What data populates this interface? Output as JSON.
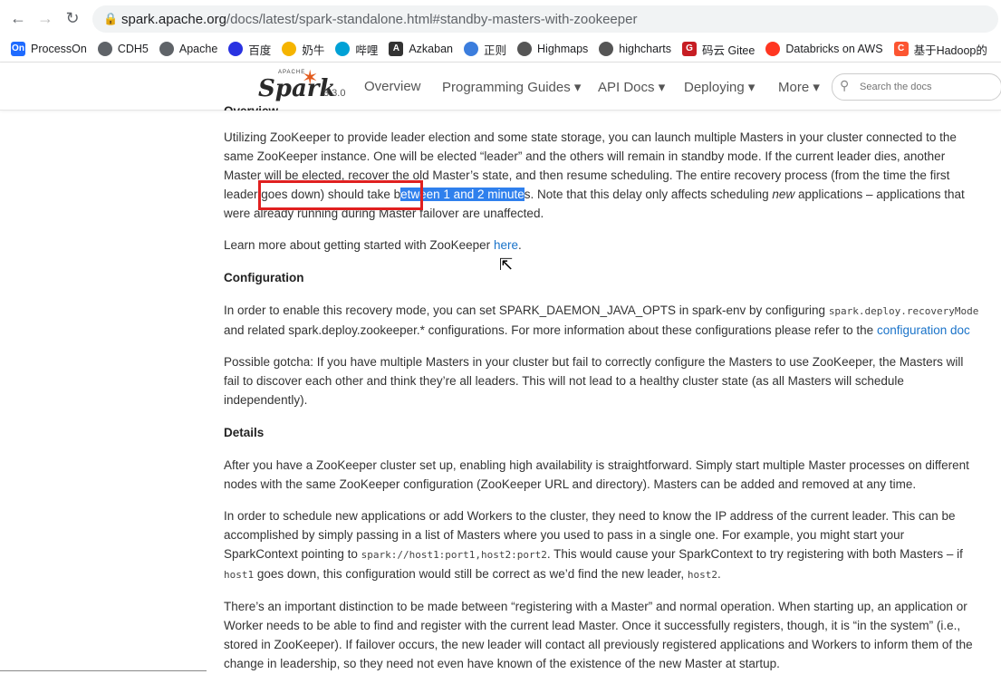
{
  "browser": {
    "url_host": "spark.apache.org",
    "url_path": "/docs/latest/spark-standalone.html#standby-masters-with-zookeeper",
    "bookmarks": [
      {
        "label": "ProcessOn",
        "icon": "On",
        "color": "#1f6bff"
      },
      {
        "label": "CDH5",
        "icon": "globe",
        "color": "#5f6368"
      },
      {
        "label": "Apache",
        "icon": "globe",
        "color": "#5f6368"
      },
      {
        "label": "百度",
        "icon": "paw",
        "color": "#2932e1"
      },
      {
        "label": "奶牛",
        "icon": "cow",
        "color": "#f5b400"
      },
      {
        "label": "哔哩",
        "icon": "tv",
        "color": "#00a1d6"
      },
      {
        "label": "Azkaban",
        "icon": "A",
        "color": "#333333"
      },
      {
        "label": "正则",
        "icon": "regex",
        "color": "#3b7ddd"
      },
      {
        "label": "Highmaps",
        "icon": "chart",
        "color": "#555555"
      },
      {
        "label": "highcharts",
        "icon": "chart",
        "color": "#555555"
      },
      {
        "label": "码云 Gitee",
        "icon": "G",
        "color": "#c71d23"
      },
      {
        "label": "Databricks on AWS",
        "icon": "db",
        "color": "#ff3621"
      },
      {
        "label": "基于Hadoop的",
        "icon": "C",
        "color": "#fc5531"
      }
    ]
  },
  "nav": {
    "version": "3.3.0",
    "apache": "APACHE",
    "logo_word": "Spark",
    "items": [
      "Overview",
      "Programming Guides",
      "API Docs",
      "Deploying",
      "More"
    ],
    "search_placeholder": "Search the docs"
  },
  "content": {
    "p1_a": "Utilizing ZooKeeper to provide leader election and some state storage, you can launch multiple Masters in your cluster connected to the same ZooKeeper instance. One will be elected “leader” and the others will remain in standby mode. If the current leader dies, another Master will be elected, recover the old Master’s state, and then resume scheduling. The entire recovery process (from the time the first leader goes down) should take b",
    "p1_hl": "etween 1 and 2 minute",
    "p1_b": "s. Note that this delay only affects scheduling ",
    "p1_em": "new",
    "p1_c": " applications – applications that were already running during Master failover are unaffected.",
    "p2_a": "Learn more about getting started with ZooKeeper ",
    "p2_link": "here",
    "p2_b": ".",
    "h_config": "Configuration",
    "p3_a": "In order to enable this recovery mode, you can set SPARK_DAEMON_JAVA_OPTS in spark-env by configuring ",
    "p3_code": "spark.deploy.recoveryMode",
    "p3_b": " and related spark.deploy.zookeeper.* configurations. For more information about these configurations please refer to the ",
    "p3_link": "configuration doc",
    "p4": "Possible gotcha: If you have multiple Masters in your cluster but fail to correctly configure the Masters to use ZooKeeper, the Masters will fail to discover each other and think they’re all leaders. This will not lead to a healthy cluster state (as all Masters will schedule independently).",
    "h_details": "Details",
    "p5": "After you have a ZooKeeper cluster set up, enabling high availability is straightforward. Simply start multiple Master processes on different nodes with the same ZooKeeper configuration (ZooKeeper URL and directory). Masters can be added and removed at any time.",
    "p6_a": "In order to schedule new applications or add Workers to the cluster, they need to know the IP address of the current leader. This can be accomplished by simply passing in a list of Masters where you used to pass in a single one. For example, you might start your SparkContext pointing to ",
    "p6_code1": "spark://host1:port1,host2:port2",
    "p6_b": ". This would cause your SparkContext to try registering with both Masters – if ",
    "p6_code2": "host1",
    "p6_c": " goes down, this configuration would still be correct as we’d find the new leader, ",
    "p6_code3": "host2",
    "p6_d": ".",
    "p7": "There’s an important distinction to be made between “registering with a Master” and normal operation. When starting up, an application or Worker needs to be able to find and register with the current lead Master. Once it successfully registers, though, it is “in the system” (i.e., stored in ZooKeeper). If failover occurs, the new leader will contact all previously registered applications and Workers to inform them of the change in leadership, so they need not even have known of the existence of the new Master at startup."
  }
}
